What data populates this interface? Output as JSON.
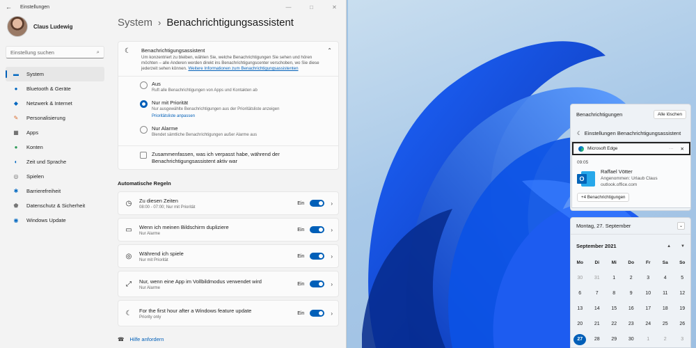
{
  "window": {
    "title": "Einstellungen",
    "back_icon": "back-arrow-icon"
  },
  "sidebar": {
    "user_name": "Claus Ludewig",
    "search_placeholder": "Einstellung suchen",
    "items": [
      {
        "label": "System",
        "icon": "system-icon",
        "glyph": "▬",
        "color": "#0067c0",
        "active": true
      },
      {
        "label": "Bluetooth & Geräte",
        "icon": "bluetooth-icon",
        "glyph": "●",
        "color": "#0067c0"
      },
      {
        "label": "Netzwerk & Internet",
        "icon": "wifi-icon",
        "glyph": "◆",
        "color": "#0067c0"
      },
      {
        "label": "Personalisierung",
        "icon": "brush-icon",
        "glyph": "✎",
        "color": "#d86a2a"
      },
      {
        "label": "Apps",
        "icon": "apps-icon",
        "glyph": "▦",
        "color": "#444"
      },
      {
        "label": "Konten",
        "icon": "account-icon",
        "glyph": "●",
        "color": "#2e9b58"
      },
      {
        "label": "Zeit und Sprache",
        "icon": "globe-clock-icon",
        "glyph": "◐",
        "color": "#0067c0"
      },
      {
        "label": "Spielen",
        "icon": "gamepad-icon",
        "glyph": "◎",
        "color": "#666"
      },
      {
        "label": "Barrierefreiheit",
        "icon": "accessibility-icon",
        "glyph": "✱",
        "color": "#0067c0"
      },
      {
        "label": "Datenschutz & Sicherheit",
        "icon": "shield-icon",
        "glyph": "⬟",
        "color": "#777"
      },
      {
        "label": "Windows Update",
        "icon": "update-icon",
        "glyph": "◉",
        "color": "#0067c0"
      }
    ]
  },
  "header": {
    "crumb": "System",
    "separator": "›",
    "current": "Benachrichtigungsassistent"
  },
  "focus": {
    "title": "Benachrichtigungsassistent",
    "description": "Um konzentriert zu bleiben, wählen Sie, welche Benachrichtigungen Sie sehen und hören möchten – alle Anderen werden direkt ins Benachrichtigungscenter verschoben, wo Sie diese jederzeit sehen können.",
    "link": "Weitere Informationen zum Benachrichtigungsassistenten",
    "options": [
      {
        "title": "Aus",
        "sub": "Ruft alle Benachrichtigungen von Apps und Kontakten ab",
        "selected": false
      },
      {
        "title": "Nur mit Priorität",
        "sub": "Nur ausgewählte Benachrichtigungen aus der Prioritätsliste anzeigen",
        "link": "Prioritätsliste anpassen",
        "selected": true
      },
      {
        "title": "Nur Alarme",
        "sub": "Blendet sämtliche Benachrichtigungen außer Alarme aus",
        "selected": false
      }
    ],
    "summary_checkbox": "Zusammenfassen, was ich verpasst habe, während der Benachrichtigungsassistent aktiv war"
  },
  "rules": {
    "title": "Automatische Regeln",
    "items": [
      {
        "title": "Zu diesen Zeiten",
        "sub": "08:00 - 07:00; Nur mit Priorität",
        "state": "Ein",
        "icon": "clock-icon",
        "glyph": "◷"
      },
      {
        "title": "Wenn ich meinen Bildschirm dupliziere",
        "sub": "Nur Alarme",
        "state": "Ein",
        "icon": "monitor-icon",
        "glyph": "▭"
      },
      {
        "title": "Während ich spiele",
        "sub": "Nur mit Priorität",
        "state": "Ein",
        "icon": "gamepad-icon",
        "glyph": "◎"
      },
      {
        "title": "Nur, wenn eine App im Vollbildmodus verwendet wird",
        "sub": "Nur Alarme",
        "state": "Ein",
        "icon": "fullscreen-icon",
        "glyph": "⤢"
      },
      {
        "title": "For the first hour after a Windows feature update",
        "sub": "Priority only",
        "state": "Ein",
        "icon": "moon-icon",
        "glyph": "☾"
      }
    ]
  },
  "help": "Hilfe anfordern",
  "notifications": {
    "title": "Benachrichtigungen",
    "clear_all": "Alle löschen",
    "settings_link": "Einstellungen Benachrichtigungsassistent",
    "app": "Microsoft Edge",
    "more_glyph": "···",
    "close_glyph": "✕",
    "time": "09:05",
    "sender": "Raffael Vötter",
    "subject": "Angenommen: Urlaub Claus",
    "source": "outlook.office.com",
    "more": "+4 Benachrichtigungen"
  },
  "calendar": {
    "date_header": "Montag, 27. September",
    "month": "September 2021",
    "weekdays": [
      "Mo",
      "Di",
      "Mi",
      "Do",
      "Fr",
      "Sa",
      "So"
    ],
    "days": [
      {
        "d": "30",
        "dim": true
      },
      {
        "d": "31",
        "dim": true
      },
      {
        "d": "1"
      },
      {
        "d": "2"
      },
      {
        "d": "3"
      },
      {
        "d": "4"
      },
      {
        "d": "5"
      },
      {
        "d": "6"
      },
      {
        "d": "7"
      },
      {
        "d": "8"
      },
      {
        "d": "9"
      },
      {
        "d": "10"
      },
      {
        "d": "11"
      },
      {
        "d": "12"
      },
      {
        "d": "13"
      },
      {
        "d": "14"
      },
      {
        "d": "15"
      },
      {
        "d": "16"
      },
      {
        "d": "17"
      },
      {
        "d": "18"
      },
      {
        "d": "19"
      },
      {
        "d": "20"
      },
      {
        "d": "21"
      },
      {
        "d": "22"
      },
      {
        "d": "23"
      },
      {
        "d": "24"
      },
      {
        "d": "25"
      },
      {
        "d": "26"
      },
      {
        "d": "27",
        "today": true
      },
      {
        "d": "28"
      },
      {
        "d": "29"
      },
      {
        "d": "30"
      },
      {
        "d": "1",
        "dim": true
      },
      {
        "d": "2",
        "dim": true
      },
      {
        "d": "3",
        "dim": true
      }
    ]
  },
  "colors": {
    "accent": "#005fb8",
    "wallpaper_blue": "#0a47d8"
  }
}
